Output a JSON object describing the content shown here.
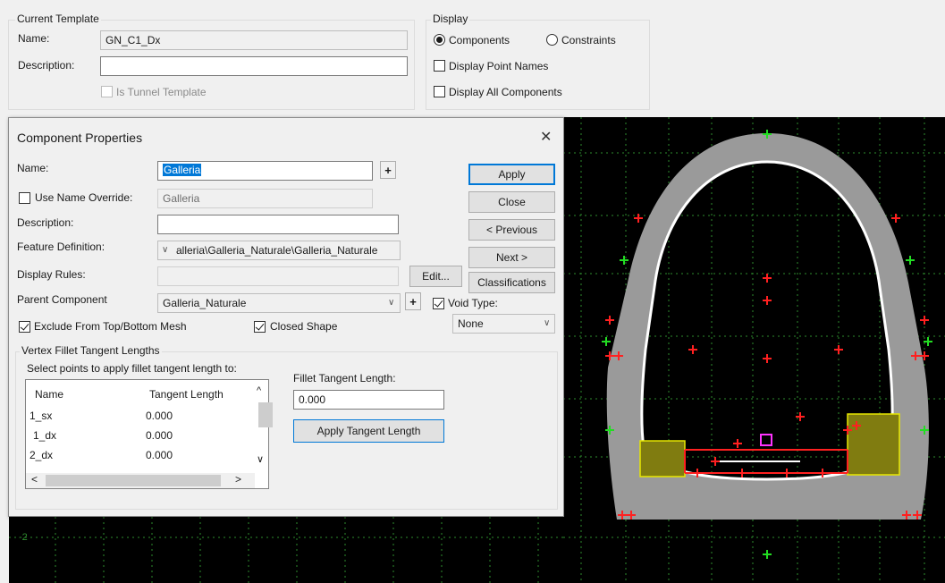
{
  "current_template": {
    "legend": "Current Template",
    "name_label": "Name:",
    "name_value": "GN_C1_Dx",
    "description_label": "Description:",
    "description_value": "",
    "tunnel_label": "Is Tunnel Template"
  },
  "display": {
    "legend": "Display",
    "components_label": "Components",
    "constraints_label": "Constraints",
    "point_names_label": "Display Point Names",
    "all_components_label": "Display All Components"
  },
  "dialog": {
    "title": "Component Properties",
    "close_glyph": "✕",
    "name_label": "Name:",
    "name_value": "Galleria",
    "use_override_label": "Use Name Override:",
    "override_value": "Galleria",
    "description_label": "Description:",
    "description_value": "",
    "feature_label": "Feature Definition:",
    "feature_value": "alleria\\Galleria_Naturale\\Galleria_Naturale",
    "display_rules_label": "Display Rules:",
    "display_rules_value": "",
    "edit_label": "Edit...",
    "parent_label": "Parent Component",
    "parent_value": "Galleria_Naturale",
    "void_label": "Void Type:",
    "void_value": "None",
    "exclude_label": "Exclude From Top/Bottom Mesh",
    "closed_label": "Closed Shape",
    "buttons": {
      "apply": "Apply",
      "close": "Close",
      "previous": "< Previous",
      "next": "Next >",
      "classifications": "Classifications"
    },
    "fillet": {
      "legend": "Vertex Fillet Tangent Lengths",
      "select_text": "Select points to apply fillet tangent length to:",
      "col_name": "Name",
      "col_length": "Tangent Length",
      "rows": [
        {
          "name": "1_sx",
          "length": "0.000"
        },
        {
          "name": "1_dx",
          "length": "0.000"
        },
        {
          "name": "2_dx",
          "length": "0.000"
        }
      ],
      "length_label": "Fillet Tangent Length:",
      "length_value": "0.000",
      "apply_length": "Apply Tangent Length"
    }
  },
  "canvas": {
    "axis_label": "-2",
    "colors": {
      "background": "#000000",
      "grid": "#2e8b2e",
      "lining": "#9a9a9a",
      "white_edge": "#ffffff",
      "red_points": "#ff2020",
      "green_points": "#22dd22",
      "olive_fill": "#807c10",
      "yellow_edge": "#e8e800",
      "magenta": "#ff33ff"
    }
  }
}
